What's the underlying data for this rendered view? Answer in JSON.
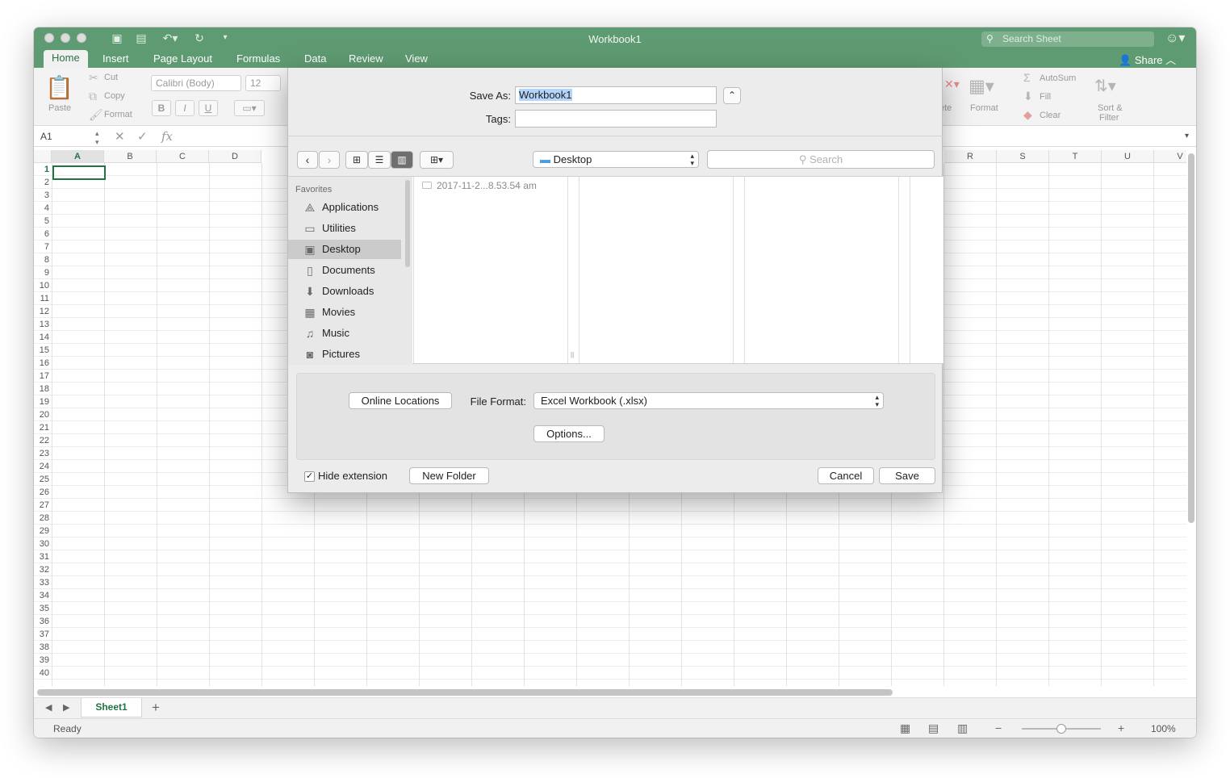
{
  "window": {
    "title": "Workbook1",
    "search_placeholder": "Search Sheet",
    "tabs": [
      "Home",
      "Insert",
      "Page Layout",
      "Formulas",
      "Data",
      "Review",
      "View"
    ],
    "share_label": "Share"
  },
  "ribbon": {
    "paste": "Paste",
    "cut": "Cut",
    "copy": "Copy",
    "format_painter": "Format",
    "font_name": "Calibri (Body)",
    "font_size": "12",
    "bold": "B",
    "italic": "I",
    "underline": "U",
    "delete_partial": "ete",
    "format": "Format",
    "autosum": "AutoSum",
    "fill": "Fill",
    "clear": "Clear",
    "sort_filter_1": "Sort &",
    "sort_filter_2": "Filter"
  },
  "formula_bar": {
    "name_box": "A1",
    "fx": "fx"
  },
  "grid": {
    "columns_left": [
      "A",
      "B",
      "C",
      "D"
    ],
    "columns_right": [
      "R",
      "S",
      "T",
      "U",
      "V"
    ],
    "rows": [
      "1",
      "2",
      "3",
      "4",
      "5",
      "6",
      "7",
      "8",
      "9",
      "10",
      "11",
      "12",
      "13",
      "14",
      "15",
      "16",
      "17",
      "18",
      "19",
      "20",
      "21",
      "22",
      "23",
      "24",
      "25",
      "26",
      "27",
      "28",
      "29",
      "30",
      "31",
      "32",
      "33",
      "34",
      "35",
      "36",
      "37",
      "38",
      "39",
      "40"
    ]
  },
  "sheets": {
    "active": "Sheet1",
    "add": "+"
  },
  "status": {
    "ready": "Ready",
    "zoom": "100%",
    "zoom_level": 0.5
  },
  "dialog": {
    "save_as_label": "Save As:",
    "save_as_value": "Workbook1",
    "tags_label": "Tags:",
    "location": "Desktop",
    "search_placeholder": "Search",
    "favorites_header": "Favorites",
    "favorites": [
      "Applications",
      "Utilities",
      "Desktop",
      "Documents",
      "Downloads",
      "Movies",
      "Music",
      "Pictures"
    ],
    "file_item": "2017-11-2...8.53.54 am",
    "online_locations": "Online Locations",
    "file_format_label": "File Format:",
    "file_format_value": "Excel Workbook (.xlsx)",
    "options": "Options...",
    "hide_extension": "Hide extension",
    "new_folder": "New Folder",
    "cancel": "Cancel",
    "save": "Save"
  }
}
